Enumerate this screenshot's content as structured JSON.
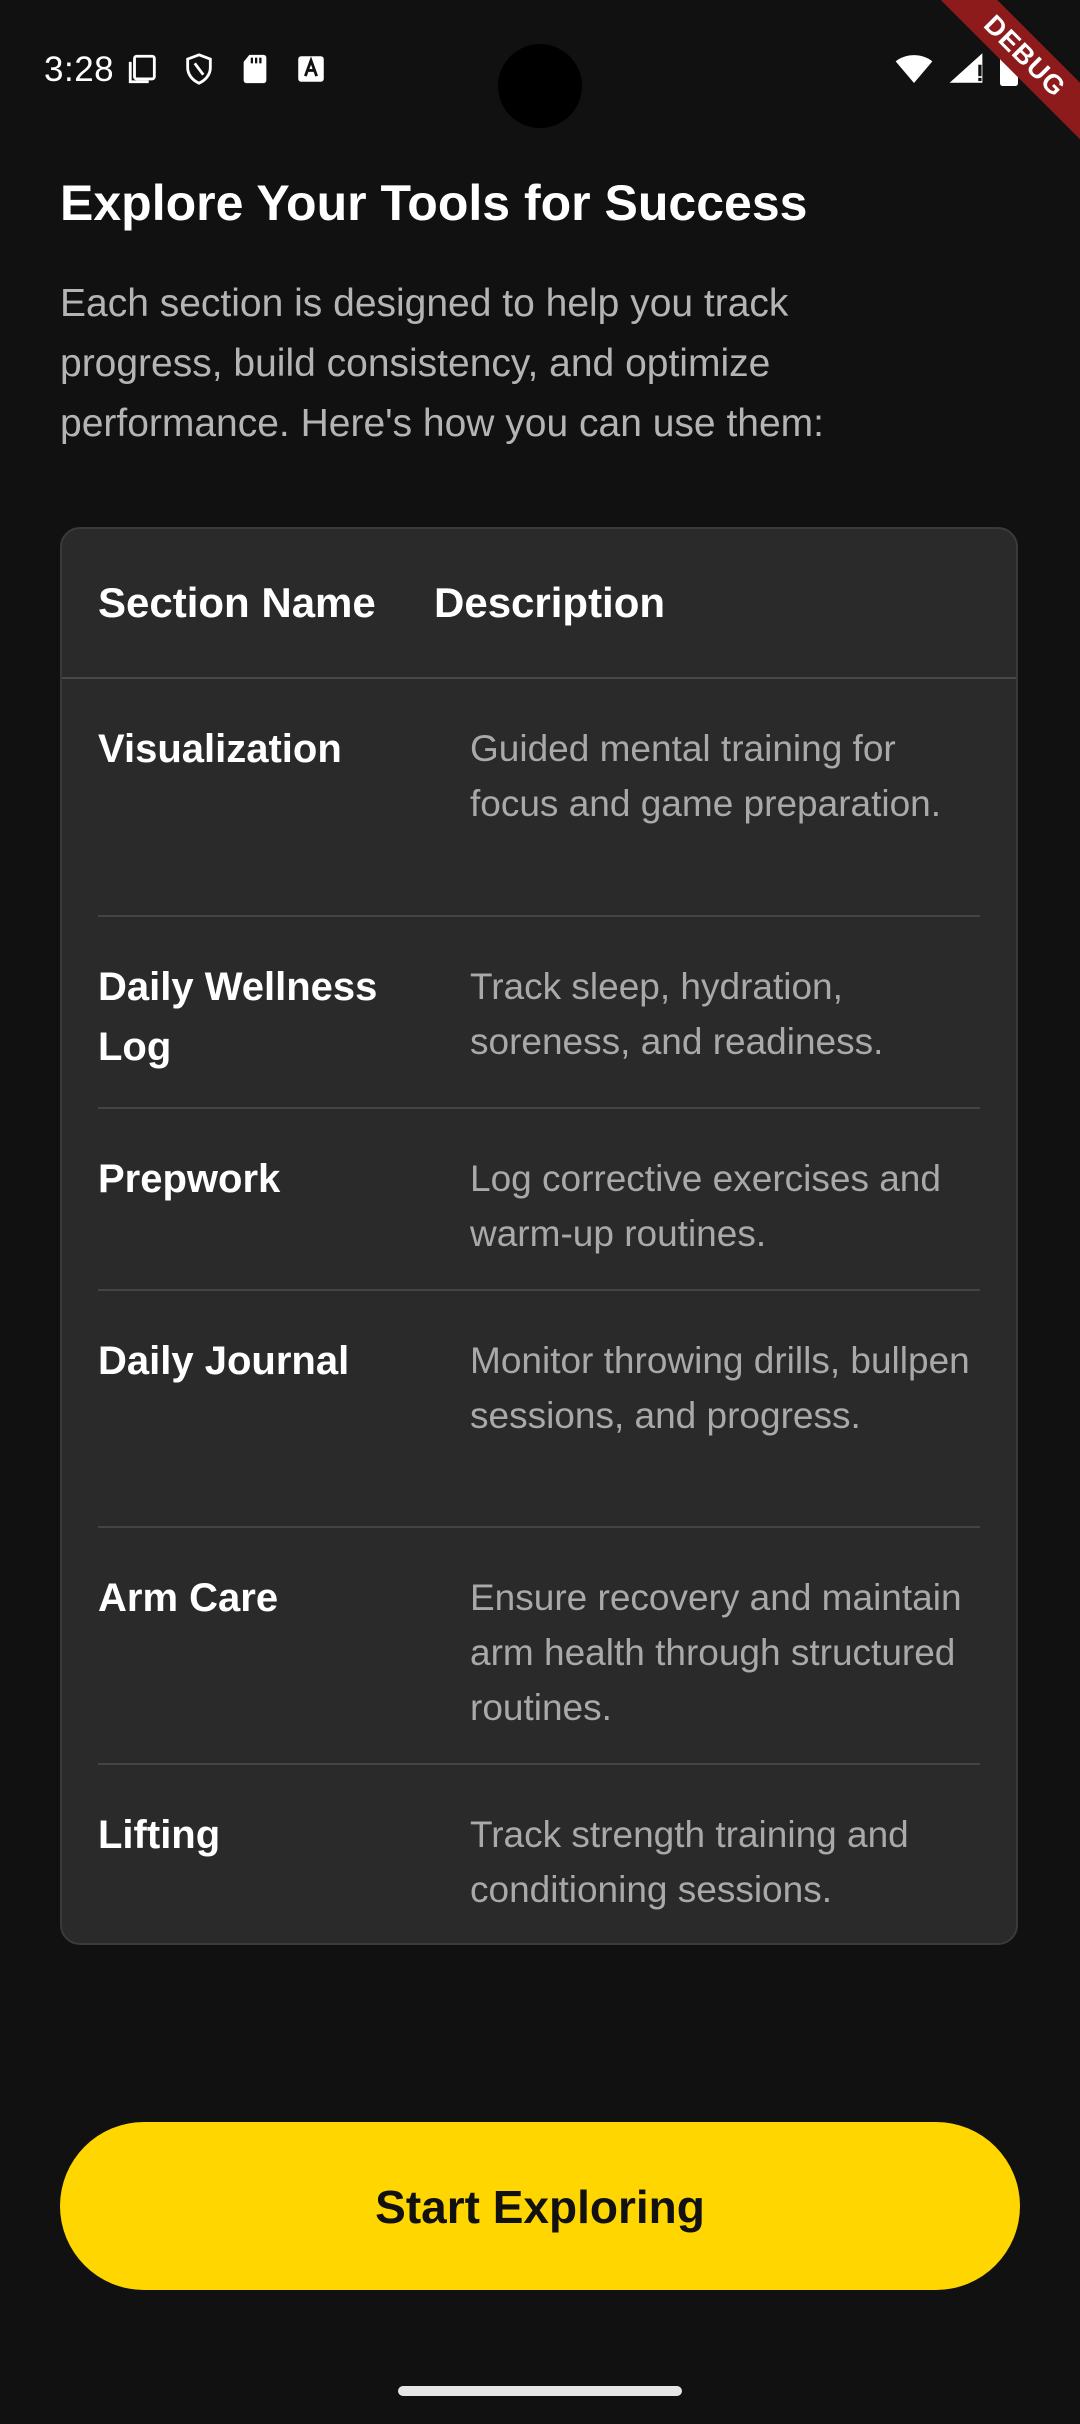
{
  "status_bar": {
    "time": "3:28",
    "left_icons": [
      "screenshot-icon",
      "shield-icon",
      "sd-card-icon",
      "keyboard-a-icon"
    ],
    "right_icons": [
      "wifi-icon",
      "signal-icon",
      "battery-icon"
    ]
  },
  "debug_banner": {
    "label": "DEBUG"
  },
  "header": {
    "title": "Explore Your Tools for Success",
    "subtitle": "Each section is designed to help you track progress, build consistency, and optimize performance. Here's how you can use them:"
  },
  "table": {
    "columns": [
      "Section Name",
      "Description"
    ],
    "rows": [
      {
        "name": "Visualization",
        "description": "Guided mental training for focus and game preparation."
      },
      {
        "name": "Daily Wellness Log",
        "description": "Track sleep, hydration, soreness, and readiness."
      },
      {
        "name": "Prepwork",
        "description": "Log corrective exercises and warm-up routines."
      },
      {
        "name": "Daily Journal",
        "description": "Monitor throwing drills, bullpen sessions, and progress."
      },
      {
        "name": "Arm Care",
        "description": "Ensure recovery and maintain arm health through structured routines."
      },
      {
        "name": "Lifting",
        "description": "Track strength training and conditioning sessions."
      }
    ]
  },
  "cta": {
    "label": "Start Exploring"
  },
  "colors": {
    "background": "#111111",
    "card": "#2a2a2a",
    "accent": "#ffd600",
    "muted_text": "#a9a9a9"
  }
}
